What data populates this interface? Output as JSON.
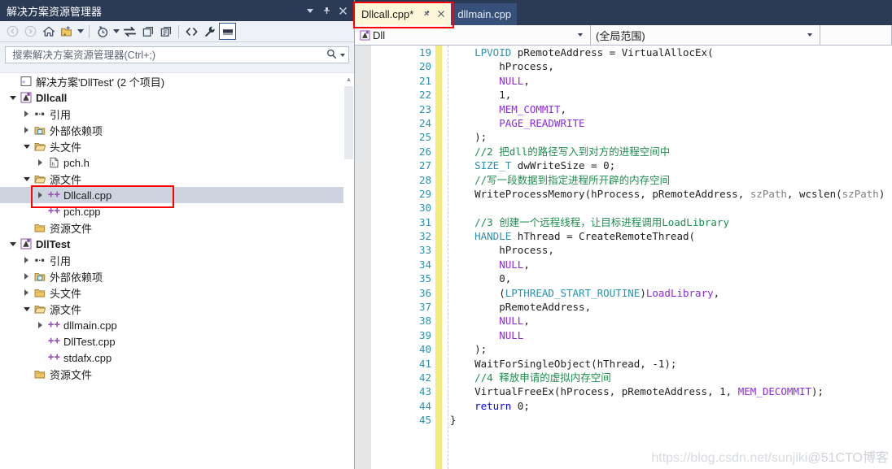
{
  "solution_explorer": {
    "title": "解决方案资源管理器",
    "titlebar_buttons": [
      {
        "name": "dropdown-caret",
        "glyph": "▾"
      },
      {
        "name": "pin",
        "glyph": "⚲"
      },
      {
        "name": "close",
        "glyph": "✕"
      }
    ],
    "toolbar": [
      {
        "name": "back-icon",
        "title": "后退",
        "disabled": true
      },
      {
        "name": "forward-icon",
        "title": "前进",
        "disabled": true
      },
      {
        "name": "home-icon",
        "title": "主页"
      },
      {
        "name": "new-folder-icon",
        "title": "新建文件夹",
        "dropdown": true
      },
      {
        "name": "pending-changes-icon",
        "title": "挂起的更改",
        "dropdown": true
      },
      {
        "name": "sync-icon",
        "title": "与活动文档同步"
      },
      {
        "name": "refresh-icon",
        "title": "刷新"
      },
      {
        "name": "show-all-files-icon",
        "title": "显示所有文件"
      },
      {
        "name": "code-view-icon",
        "title": "查看代码"
      },
      {
        "name": "properties-icon",
        "title": "属性"
      },
      {
        "name": "preview-selected-icon",
        "title": "预览选定项",
        "selected": true
      }
    ],
    "search": {
      "placeholder": "搜索解决方案资源管理器(Ctrl+;)",
      "value": "",
      "icon": "search-icon"
    },
    "tree": [
      {
        "depth": 0,
        "expander": "none",
        "icon": "solution-icon",
        "label": "解决方案'DllTest' (2 个项目)",
        "bold": false
      },
      {
        "depth": 0,
        "expander": "down",
        "icon": "project-icon",
        "label": "Dllcall",
        "bold": true
      },
      {
        "depth": 1,
        "expander": "right",
        "icon": "references-icon",
        "label": "引用",
        "bold": false
      },
      {
        "depth": 1,
        "expander": "right",
        "icon": "ext-deps-icon",
        "label": "外部依赖项",
        "bold": false
      },
      {
        "depth": 1,
        "expander": "down",
        "icon": "folder-open-icon",
        "label": "头文件",
        "bold": false
      },
      {
        "depth": 2,
        "expander": "right",
        "icon": "header-file-icon",
        "label": "pch.h",
        "bold": false
      },
      {
        "depth": 1,
        "expander": "down",
        "icon": "folder-open-icon",
        "label": "源文件",
        "bold": false
      },
      {
        "depth": 2,
        "expander": "right",
        "icon": "cpp-file-icon",
        "label": "Dllcall.cpp",
        "bold": false,
        "selected": true
      },
      {
        "depth": 2,
        "expander": "none",
        "icon": "cpp-file-icon",
        "label": "pch.cpp",
        "bold": false
      },
      {
        "depth": 1,
        "expander": "none",
        "icon": "folder-icon",
        "label": "资源文件",
        "bold": false
      },
      {
        "depth": 0,
        "expander": "down",
        "icon": "project-icon",
        "label": "DllTest",
        "bold": true
      },
      {
        "depth": 1,
        "expander": "right",
        "icon": "references-icon",
        "label": "引用",
        "bold": false
      },
      {
        "depth": 1,
        "expander": "right",
        "icon": "ext-deps-icon",
        "label": "外部依赖项",
        "bold": false
      },
      {
        "depth": 1,
        "expander": "right",
        "icon": "folder-icon",
        "label": "头文件",
        "bold": false
      },
      {
        "depth": 1,
        "expander": "down",
        "icon": "folder-open-icon",
        "label": "源文件",
        "bold": false
      },
      {
        "depth": 2,
        "expander": "right",
        "icon": "cpp-file-icon",
        "label": "dllmain.cpp",
        "bold": false
      },
      {
        "depth": 2,
        "expander": "none",
        "icon": "cpp-file-icon",
        "label": "DllTest.cpp",
        "bold": false
      },
      {
        "depth": 2,
        "expander": "none",
        "icon": "cpp-file-icon",
        "label": "stdafx.cpp",
        "bold": false
      },
      {
        "depth": 1,
        "expander": "none",
        "icon": "folder-icon",
        "label": "资源文件",
        "bold": false
      }
    ]
  },
  "editor": {
    "tabs": [
      {
        "label": "Dllcall.cpp*",
        "active": true,
        "pin_glyph": "⚲",
        "close_glyph": "✕",
        "annotated": true
      },
      {
        "label": "dllmain.cpp",
        "active": false
      }
    ],
    "navbar": {
      "class_combo": "Dll",
      "class_icon": "project-icon",
      "member_combo": "(全局范围)",
      "third_combo": ""
    },
    "code": [
      {
        "num": "19",
        "tokens": [
          {
            "t": "    ",
            "c": "n"
          },
          {
            "t": "LPVOID",
            "c": "t"
          },
          {
            "t": " pRemoteAddress = VirtualAllocEx(",
            "c": "n"
          }
        ]
      },
      {
        "num": "20",
        "tokens": [
          {
            "t": "        hProcess,",
            "c": "n"
          }
        ]
      },
      {
        "num": "21",
        "tokens": [
          {
            "t": "        ",
            "c": "n"
          },
          {
            "t": "NULL",
            "c": "m"
          },
          {
            "t": ",",
            "c": "n"
          }
        ]
      },
      {
        "num": "22",
        "tokens": [
          {
            "t": "        1,",
            "c": "n"
          }
        ]
      },
      {
        "num": "23",
        "tokens": [
          {
            "t": "        ",
            "c": "n"
          },
          {
            "t": "MEM_COMMIT",
            "c": "m"
          },
          {
            "t": ",",
            "c": "n"
          }
        ]
      },
      {
        "num": "24",
        "tokens": [
          {
            "t": "        ",
            "c": "n"
          },
          {
            "t": "PAGE_READWRITE",
            "c": "m"
          }
        ]
      },
      {
        "num": "25",
        "tokens": [
          {
            "t": "    );",
            "c": "n"
          }
        ]
      },
      {
        "num": "26",
        "tokens": [
          {
            "t": "    //2 把dll的路径写入到对方的进程空间中",
            "c": "cm"
          }
        ]
      },
      {
        "num": "27",
        "tokens": [
          {
            "t": "    ",
            "c": "n"
          },
          {
            "t": "SIZE_T",
            "c": "t"
          },
          {
            "t": " dwWriteSize = 0;",
            "c": "n"
          }
        ]
      },
      {
        "num": "28",
        "tokens": [
          {
            "t": "    //写一段数据到指定进程所开辟的内存空间",
            "c": "cm"
          }
        ]
      },
      {
        "num": "29",
        "tokens": [
          {
            "t": "    WriteProcessMemory(hProcess, pRemoteAddress, ",
            "c": "n"
          },
          {
            "t": "szPath",
            "c": "pl"
          },
          {
            "t": ", wcslen(",
            "c": "n"
          },
          {
            "t": "szPath",
            "c": "pl"
          },
          {
            "t": ")",
            "c": "n"
          }
        ]
      },
      {
        "num": "30",
        "tokens": [
          {
            "t": "",
            "c": "n"
          }
        ]
      },
      {
        "num": "31",
        "tokens": [
          {
            "t": "    //3 创建一个远程线程，让目标进程调用LoadLibrary",
            "c": "cm"
          }
        ]
      },
      {
        "num": "32",
        "tokens": [
          {
            "t": "    ",
            "c": "n"
          },
          {
            "t": "HANDLE",
            "c": "t"
          },
          {
            "t": " hThread = CreateRemoteThread(",
            "c": "n"
          }
        ]
      },
      {
        "num": "33",
        "tokens": [
          {
            "t": "        hProcess,",
            "c": "n"
          }
        ]
      },
      {
        "num": "34",
        "tokens": [
          {
            "t": "        ",
            "c": "n"
          },
          {
            "t": "NULL",
            "c": "m"
          },
          {
            "t": ",",
            "c": "n"
          }
        ]
      },
      {
        "num": "35",
        "tokens": [
          {
            "t": "        0,",
            "c": "n"
          }
        ]
      },
      {
        "num": "36",
        "tokens": [
          {
            "t": "        (",
            "c": "n"
          },
          {
            "t": "LPTHREAD_START_ROUTINE",
            "c": "t"
          },
          {
            "t": ")",
            "c": "n"
          },
          {
            "t": "LoadLibrary",
            "c": "m"
          },
          {
            "t": ",",
            "c": "n"
          }
        ]
      },
      {
        "num": "37",
        "tokens": [
          {
            "t": "        pRemoteAddress,",
            "c": "n"
          }
        ]
      },
      {
        "num": "38",
        "tokens": [
          {
            "t": "        ",
            "c": "n"
          },
          {
            "t": "NULL",
            "c": "m"
          },
          {
            "t": ",",
            "c": "n"
          }
        ]
      },
      {
        "num": "39",
        "tokens": [
          {
            "t": "        ",
            "c": "n"
          },
          {
            "t": "NULL",
            "c": "m"
          }
        ]
      },
      {
        "num": "40",
        "tokens": [
          {
            "t": "    );",
            "c": "n"
          }
        ]
      },
      {
        "num": "41",
        "tokens": [
          {
            "t": "    WaitForSingleObject(hThread, -1);",
            "c": "n"
          }
        ]
      },
      {
        "num": "42",
        "tokens": [
          {
            "t": "    //4 释放申请的虚拟内存空间",
            "c": "cm"
          }
        ]
      },
      {
        "num": "43",
        "tokens": [
          {
            "t": "    VirtualFreeEx(hProcess, pRemoteAddress, 1, ",
            "c": "n"
          },
          {
            "t": "MEM_DECOMMIT",
            "c": "m"
          },
          {
            "t": ");",
            "c": "n"
          }
        ]
      },
      {
        "num": "44",
        "tokens": [
          {
            "t": "    ",
            "c": "n"
          },
          {
            "t": "return",
            "c": "k"
          },
          {
            "t": " 0;",
            "c": "n"
          }
        ]
      },
      {
        "num": "45",
        "tokens": [
          {
            "t": "}",
            "c": "n"
          }
        ]
      }
    ],
    "watermark_primary": "https://blog.csdn.net/sunjiki",
    "watermark_secondary": "@51CTO博客"
  },
  "colors": {
    "chrome_dark": "#2b3a55",
    "tab_active_bg": "#fdf6d8",
    "tab_inactive_bg": "#36507a",
    "annotation_red": "#ff0000",
    "change_bar_yellow": "#f5ea7c",
    "selection_gray": "#cdd4e0",
    "linenum_blue": "#2b91af",
    "comment_green": "#1d8f4e",
    "macro_purple": "#8a2be2",
    "keyword_blue": "#0000ff"
  }
}
